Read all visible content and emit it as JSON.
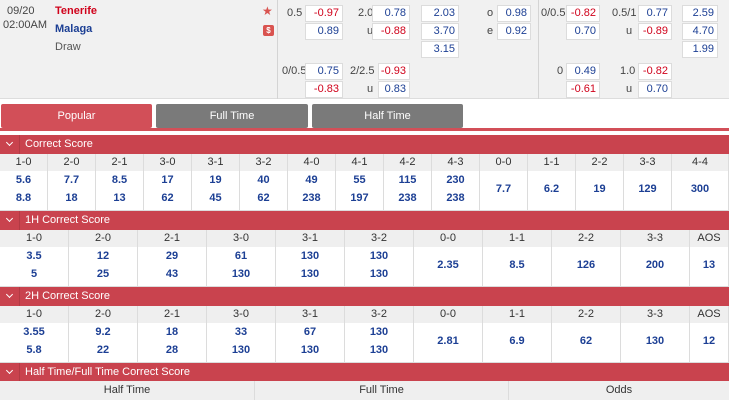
{
  "match": {
    "date": "09/20",
    "time": "02:00AM",
    "home": "Tenerife",
    "away": "Malaga",
    "draw": "Draw",
    "fav_icon": "star-icon",
    "money_icon": "dollar-icon",
    "money_label": "$",
    "hdp": {
      "line1": "0.5",
      "o1": "-0.97",
      "o2": "0.89",
      "line2": "0/0.5",
      "o3": "0.75",
      "o4": "-0.83"
    },
    "ou": {
      "line1": "2.0",
      "o1": "0.78",
      "u_label": "u",
      "o2": "-0.88",
      "line2": "2/2.5",
      "o3": "-0.93",
      "o4": "0.83"
    },
    "x12": {
      "h": "2.03",
      "a": "3.70",
      "d": "3.15"
    },
    "oe": {
      "o_label": "o",
      "o": "0.98",
      "e_label": "e",
      "e": "0.92"
    },
    "ht_hdp": {
      "line1": "0/0.5",
      "o1": "-0.82",
      "o2": "0.70",
      "line2": "0",
      "o3": "0.49",
      "o4": "-0.61"
    },
    "ht_ou": {
      "line1": "0.5/1",
      "o1": "0.77",
      "u_label": "u",
      "o2": "-0.89",
      "line2": "1.0",
      "o3": "-0.82",
      "o4": "0.70"
    },
    "ht_1x2": {
      "h": "2.59",
      "a": "4.70",
      "d": "1.99"
    }
  },
  "tabs": [
    {
      "label": "Popular",
      "active": true
    },
    {
      "label": "Full Time",
      "active": false
    },
    {
      "label": "Half Time",
      "active": false
    }
  ],
  "correct_score": {
    "title": "Correct Score",
    "headers": [
      "1-0",
      "2-0",
      "2-1",
      "3-0",
      "3-1",
      "3-2",
      "4-0",
      "4-1",
      "4-2",
      "4-3",
      "0-0",
      "1-1",
      "2-2",
      "3-3",
      "4-4"
    ],
    "top": [
      "5.6",
      "7.7",
      "8.5",
      "17",
      "19",
      "40",
      "49",
      "55",
      "115",
      "230",
      "7.7",
      "6.2",
      "19",
      "129",
      "300"
    ],
    "bottom": [
      "8.8",
      "18",
      "13",
      "62",
      "45",
      "62",
      "238",
      "197",
      "238",
      "238",
      "",
      "",
      "",
      "",
      ""
    ]
  },
  "h1_correct_score": {
    "title": "1H Correct Score",
    "headers": [
      "1-0",
      "2-0",
      "2-1",
      "3-0",
      "3-1",
      "3-2",
      "0-0",
      "1-1",
      "2-2",
      "3-3",
      "AOS"
    ],
    "top": [
      "3.5",
      "12",
      "29",
      "61",
      "130",
      "130",
      "2.35",
      "8.5",
      "126",
      "200",
      "13"
    ],
    "bottom": [
      "5",
      "25",
      "43",
      "130",
      "130",
      "130",
      "",
      "",
      "",
      "",
      ""
    ]
  },
  "h2_correct_score": {
    "title": "2H Correct Score",
    "headers": [
      "1-0",
      "2-0",
      "2-1",
      "3-0",
      "3-1",
      "3-2",
      "0-0",
      "1-1",
      "2-2",
      "3-3",
      "AOS"
    ],
    "top": [
      "3.55",
      "9.2",
      "18",
      "33",
      "67",
      "130",
      "2.81",
      "6.9",
      "62",
      "130",
      "12"
    ],
    "bottom": [
      "5.8",
      "22",
      "28",
      "130",
      "130",
      "130",
      "",
      "",
      "",
      "",
      ""
    ]
  },
  "htft": {
    "title": "Half Time/Full Time Correct Score",
    "headers": [
      "Half Time",
      "Full Time",
      "Odds"
    ]
  }
}
